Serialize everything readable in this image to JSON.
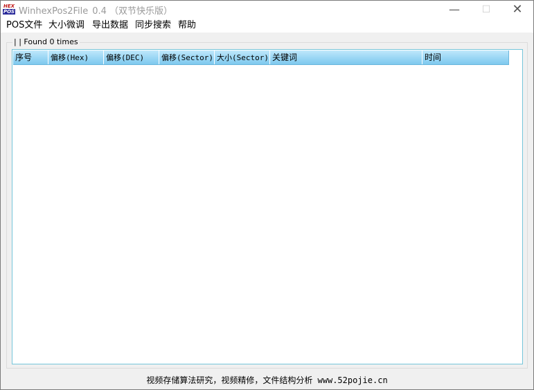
{
  "window": {
    "app_name": "WinhexPos2File",
    "version": "0.4",
    "subtitle": "（双节快乐版）",
    "icon_text_top": "HEX",
    "icon_text_bottom": "POS",
    "controls": {
      "minimize": "—",
      "maximize": "☐",
      "close": "✕"
    }
  },
  "menu": {
    "items": [
      {
        "label": "POS文件"
      },
      {
        "label": "大小微调"
      },
      {
        "label": "导出数据"
      },
      {
        "label": "同步搜索"
      },
      {
        "label": "帮助"
      }
    ]
  },
  "results_group": {
    "legend": "| | Found 0 times"
  },
  "results_table": {
    "columns": [
      {
        "label": "序号"
      },
      {
        "label": "偏移(Hex)"
      },
      {
        "label": "偏移(DEC)"
      },
      {
        "label": "偏移(Sector)"
      },
      {
        "label": "大小(Sector)"
      },
      {
        "label": "关键词"
      },
      {
        "label": "时间"
      }
    ],
    "rows": []
  },
  "status": {
    "text": "视频存储算法研究，视频精修，文件结构分析 www.52pojie.cn"
  },
  "colors": {
    "header_gradient_top": "#bfe8fb",
    "header_gradient_bottom": "#7fc9ee",
    "list_border": "#74c5da",
    "title_text": "#9a9a9a"
  }
}
